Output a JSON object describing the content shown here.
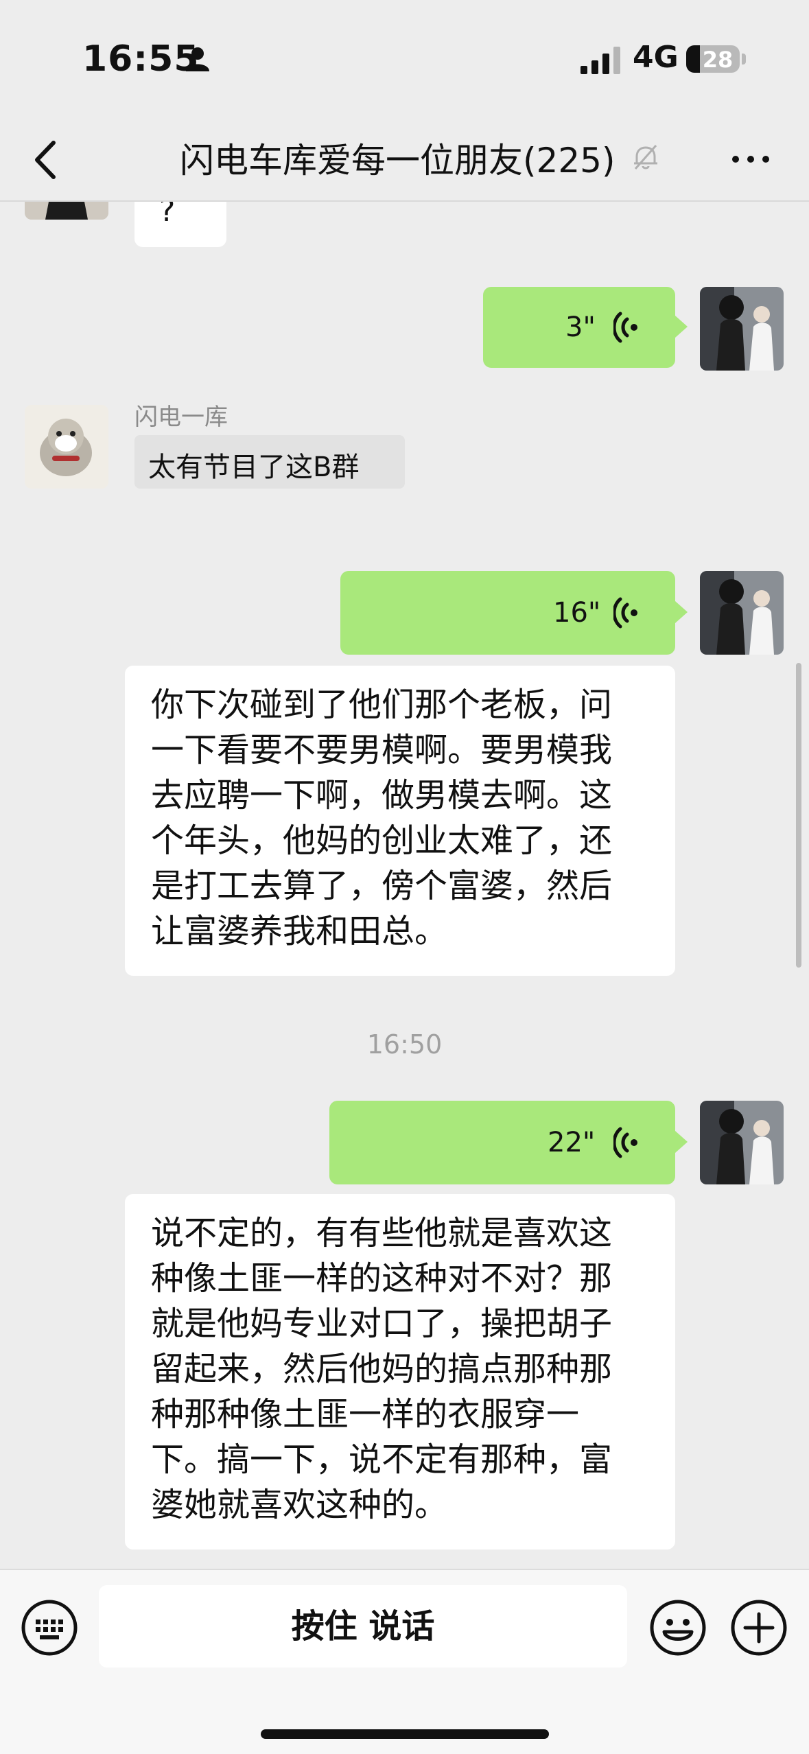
{
  "status_bar": {
    "time": "16:55",
    "network": "4G",
    "battery": "28"
  },
  "nav": {
    "title": "闪电车库爱每一位朋友(225)"
  },
  "messages": {
    "m0": {
      "text": "?"
    },
    "m1": {
      "duration": "3\""
    },
    "m2": {
      "sender": "闪电一库",
      "text": "太有节目了这B群"
    },
    "m3": {
      "duration": "16\""
    },
    "m4": {
      "lines": [
        "你下次碰到了他们那个老板，问",
        "一下看要不要男模啊。要男模我",
        "去应聘一下啊，做男模去啊。这",
        "个年头，他妈的创业太难了，还",
        "是打工去算了，傍个富婆，然后",
        "让富婆养我和田总。"
      ]
    },
    "ts1": "16:50",
    "m5": {
      "duration": "22\""
    },
    "m6": {
      "lines": [
        "说不定的，有有些他就是喜欢这",
        "种像土匪一样的这种对不对？那",
        "就是他妈专业对口了，操把胡子",
        "留起来，然后他妈的搞点那种那",
        "种那种像土匪一样的衣服穿一",
        "下。搞一下，说不定有那种，富",
        "婆她就喜欢这种的。"
      ]
    }
  },
  "input_bar": {
    "hold_to_talk": "按住 说话"
  },
  "colors": {
    "self_bubble": "#a9e87b",
    "other_bubble": "#ffffff",
    "background": "#ededed"
  }
}
